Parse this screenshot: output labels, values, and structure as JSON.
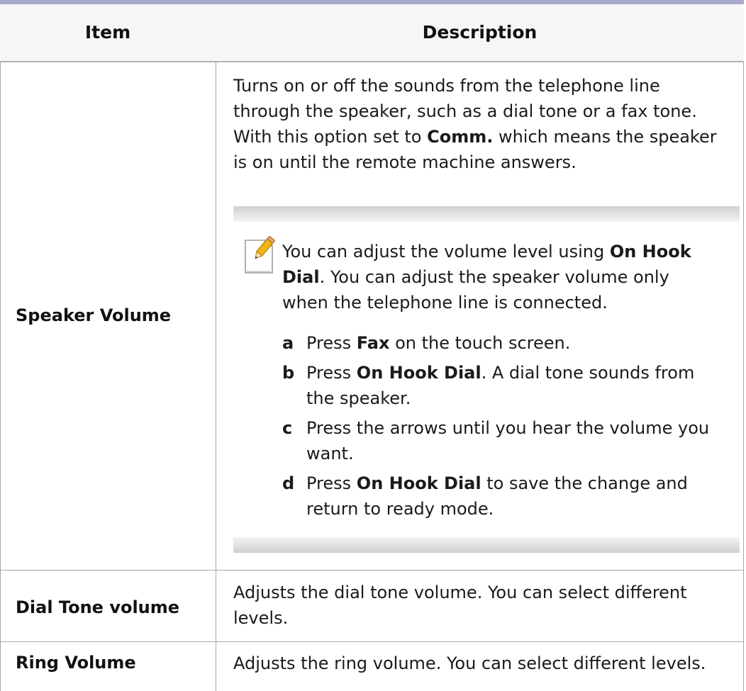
{
  "table": {
    "header": {
      "item": "Item",
      "description": "Description"
    },
    "rows": [
      {
        "item": "Speaker Volume",
        "description": {
          "line1": "Turns on or off the sounds from the telephone line",
          "line2": "through the speaker, such as a dial tone or a fax tone.",
          "line3_pre": "With this option set to ",
          "line3_bold": "Comm.",
          "line3_post": " which means the speaker",
          "line4": "is on until the remote machine answers."
        },
        "note": {
          "icon": "note-pencil-icon",
          "l1_pre": "You can adjust the volume level using ",
          "l1_bold": "On Hook",
          "l2_bold": "Dial",
          "l2_post": ". You can adjust the speaker volume only",
          "l3": "when the telephone line is connected.",
          "steps": [
            {
              "letter": "a",
              "pre": "Press ",
              "bold": "Fax",
              "post": " on the touch screen.",
              "cont": ""
            },
            {
              "letter": "b",
              "pre": "Press ",
              "bold": "On Hook Dial",
              "post": ". A dial tone sounds from",
              "cont": "the speaker."
            },
            {
              "letter": "c",
              "pre": "Press the arrows until you hear the volume you",
              "bold": "",
              "post": "",
              "cont": "want."
            },
            {
              "letter": "d",
              "pre": "Press ",
              "bold": "On Hook Dial",
              "post": " to save the change and",
              "cont": "return to ready mode."
            }
          ]
        }
      },
      {
        "item": "Dial Tone volume",
        "description": {
          "line1": "Adjusts the dial tone volume. You can select different",
          "line2": "levels."
        }
      },
      {
        "item": "Ring Volume",
        "description": {
          "line1": "Adjusts the ring volume. You can select different levels."
        }
      }
    ]
  }
}
